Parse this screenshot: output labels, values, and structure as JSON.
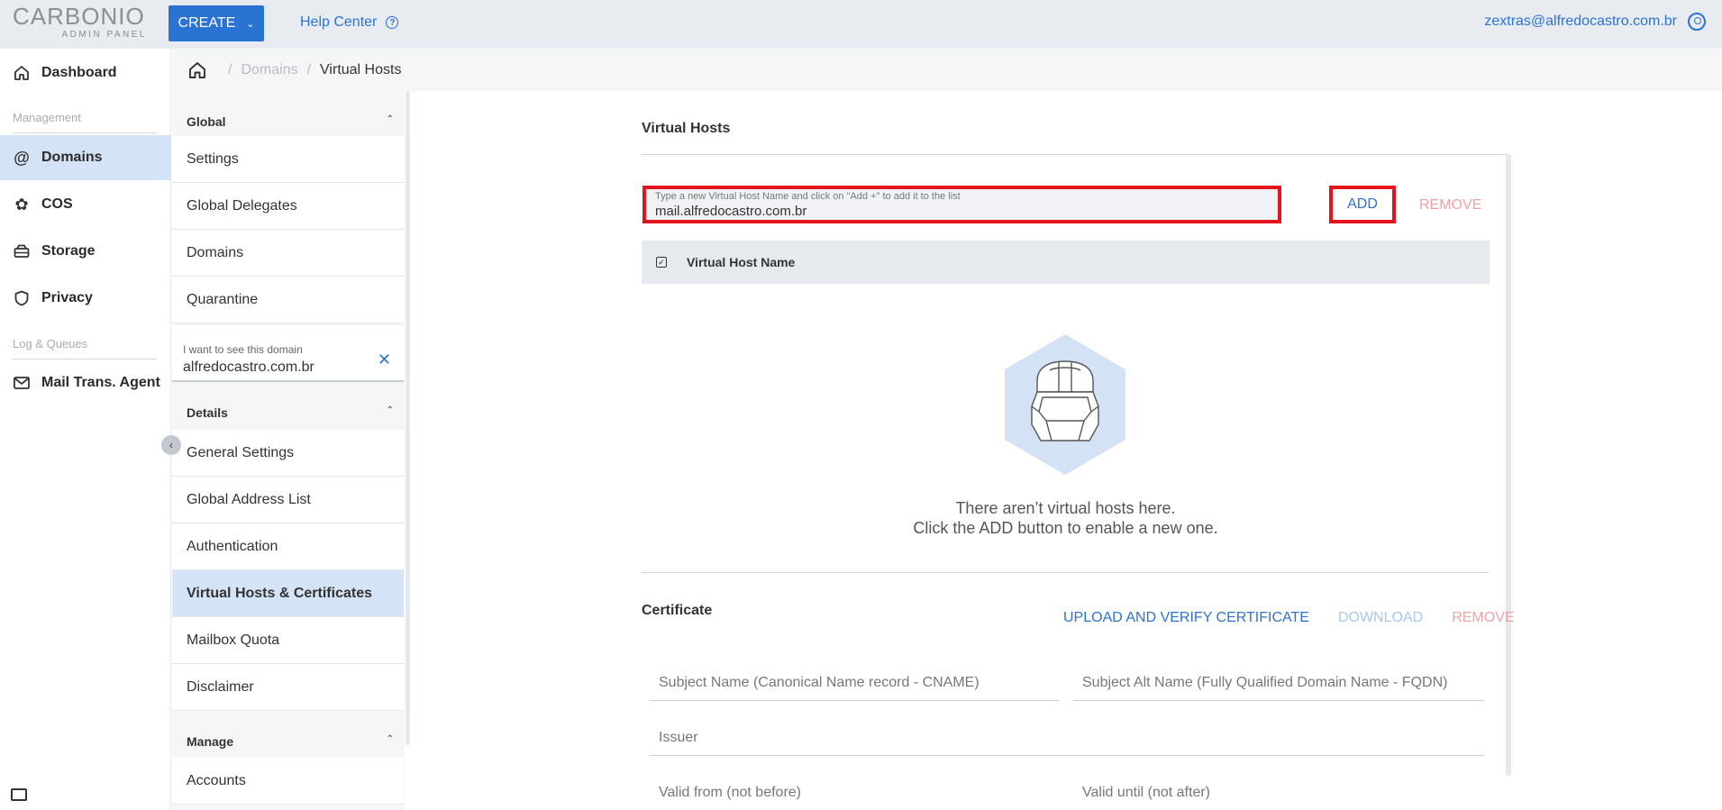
{
  "header": {
    "logo_name": "CARBONIO",
    "logo_sub": "ADMIN PANEL",
    "create_label": "CREATE",
    "help_label": "Help Center",
    "user_email": "zextras@alfredocastro.com.br"
  },
  "leftnav": {
    "dashboard": "Dashboard",
    "section_management": "Management",
    "domains": "Domains",
    "cos": "COS",
    "storage": "Storage",
    "privacy": "Privacy",
    "section_logs": "Log & Queues",
    "mta": "Mail Trans. Agent"
  },
  "breadcrumb": {
    "parent": "Domains",
    "current": "Virtual Hosts"
  },
  "submenu": {
    "global_title": "Global",
    "global_items": [
      "Settings",
      "Global Delegates",
      "Domains",
      "Quarantine"
    ],
    "domain_filter_label": "I want to see this domain",
    "domain_filter_value": "alfredocastro.com.br",
    "details_title": "Details",
    "details_items": [
      "General Settings",
      "Global Address List",
      "Authentication",
      "Virtual Hosts & Certificates",
      "Mailbox Quota",
      "Disclaimer"
    ],
    "manage_title": "Manage",
    "manage_items": [
      "Accounts"
    ]
  },
  "virtual_hosts": {
    "title": "Virtual Hosts",
    "input_placeholder": "Type a new Virtual Host Name and click on \"Add +\" to add it to the list",
    "input_value": "mail.alfredocastro.com.br",
    "add_label": "ADD",
    "remove_label": "REMOVE",
    "column_name": "Virtual Host Name",
    "empty_line1": "There aren’t virtual hosts here.",
    "empty_line2": "Click the ADD button to enable a new one."
  },
  "certificate": {
    "title": "Certificate",
    "upload_label": "UPLOAD AND VERIFY CERTIFICATE",
    "download_label": "DOWNLOAD",
    "remove_label": "REMOVE",
    "subject_name": "Subject Name (Canonical Name record - CNAME)",
    "subject_alt": "Subject Alt Name (Fully Qualified Domain Name - FQDN)",
    "issuer": "Issuer",
    "valid_from": "Valid from (not before)",
    "valid_until": "Valid until (not after)"
  },
  "colors": {
    "primary": "#2b73d2",
    "highlight_border": "#e3141c",
    "active_bg": "#d5e3f6",
    "danger_muted": "#f1a1a1"
  }
}
